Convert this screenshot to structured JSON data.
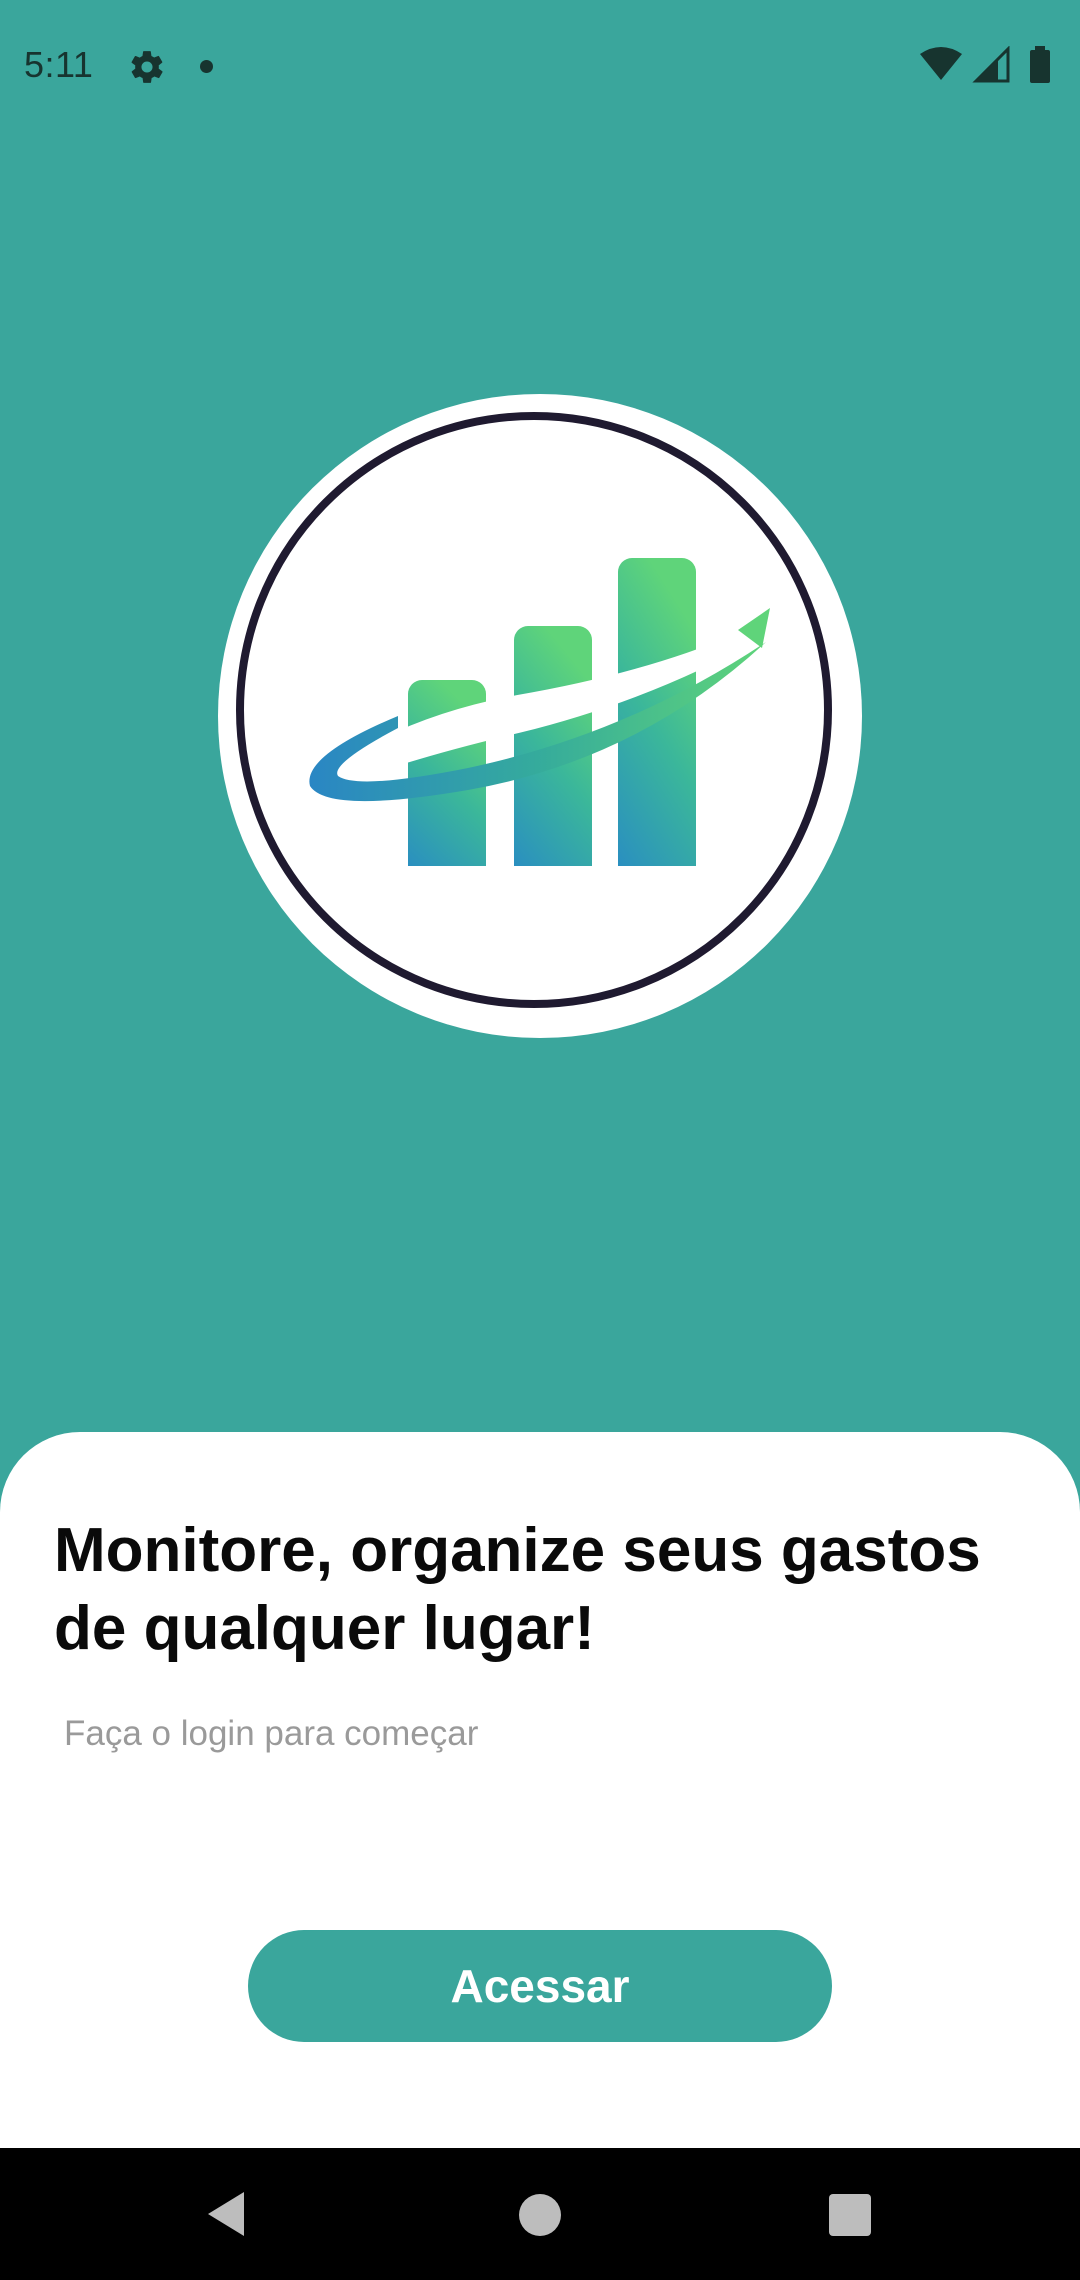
{
  "status_bar": {
    "time": "5:11",
    "icons": [
      "gear-icon",
      "notification-dot-icon",
      "wifi-icon",
      "cell-signal-icon",
      "battery-icon"
    ]
  },
  "logo": {
    "icon": "growth-chart-logo-icon",
    "colors": {
      "teal": "#2fa59a",
      "green": "#5fd47a",
      "blue": "#2a86c4",
      "ring": "#1f1a30"
    }
  },
  "onboarding": {
    "headline": "Monitore, organize seus gastos de qualquer lugar!",
    "subtitle": "Faça o login para começar",
    "cta_label": "Acessar"
  },
  "nav_bar": {
    "icons": [
      "back-icon",
      "home-icon",
      "recents-icon"
    ]
  },
  "theme": {
    "primary": "#3aa69c",
    "sheet": "#ffffff",
    "text": "#0a0a0a",
    "muted": "#9a9a9a"
  }
}
